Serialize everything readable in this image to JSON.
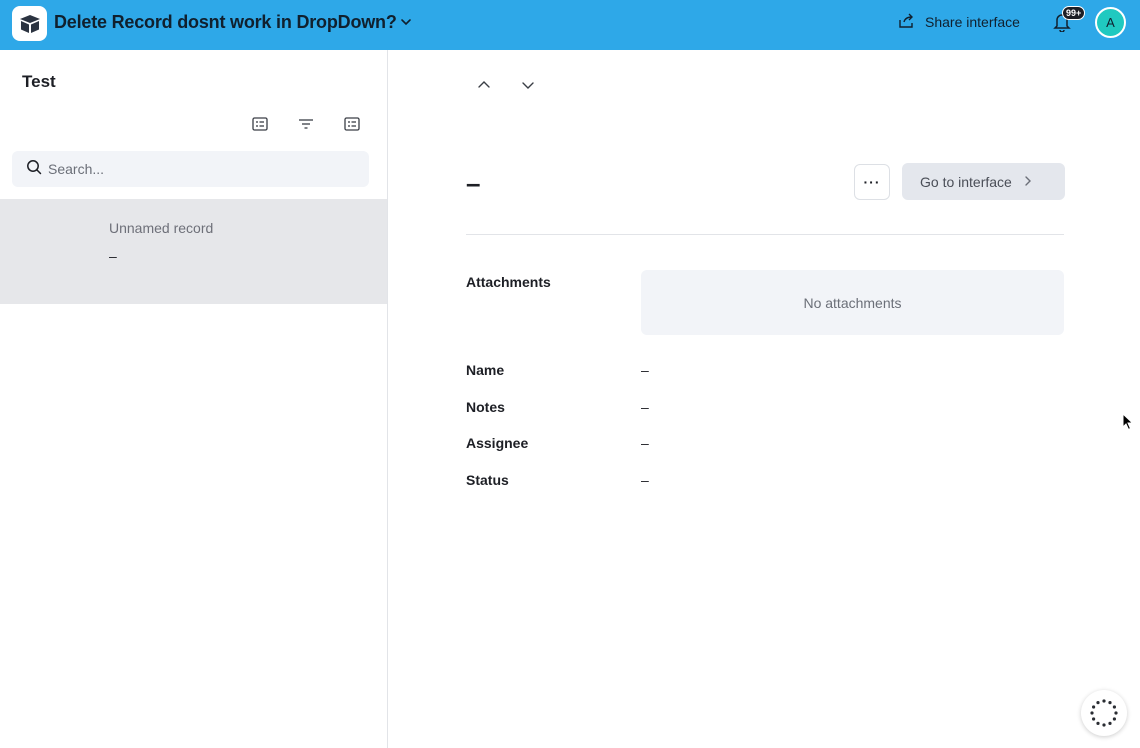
{
  "header": {
    "title": "Delete Record dosnt work in DropDown?",
    "share_label": "Share interface",
    "notification_badge": "99+",
    "avatar_initial": "A",
    "accent_color": "#2ea8e8"
  },
  "sidebar": {
    "title": "Test",
    "search_placeholder": "Search...",
    "records": [
      {
        "name": "Unnamed record",
        "value": "–"
      }
    ]
  },
  "detail": {
    "title": "–",
    "more_label": "···",
    "goto_label": "Go to interface",
    "fields": [
      {
        "label": "Attachments",
        "value": "No attachments"
      },
      {
        "label": "Name",
        "value": "–"
      },
      {
        "label": "Notes",
        "value": "–"
      },
      {
        "label": "Assignee",
        "value": "–"
      },
      {
        "label": "Status",
        "value": "–"
      }
    ]
  },
  "icons": [
    "app-logo-icon",
    "chevron-down-icon",
    "share-icon",
    "bell-icon",
    "list-icon",
    "filter-icon",
    "search-icon",
    "chevron-up-icon",
    "chevron-right-icon",
    "loading-icon",
    "cursor-icon"
  ]
}
